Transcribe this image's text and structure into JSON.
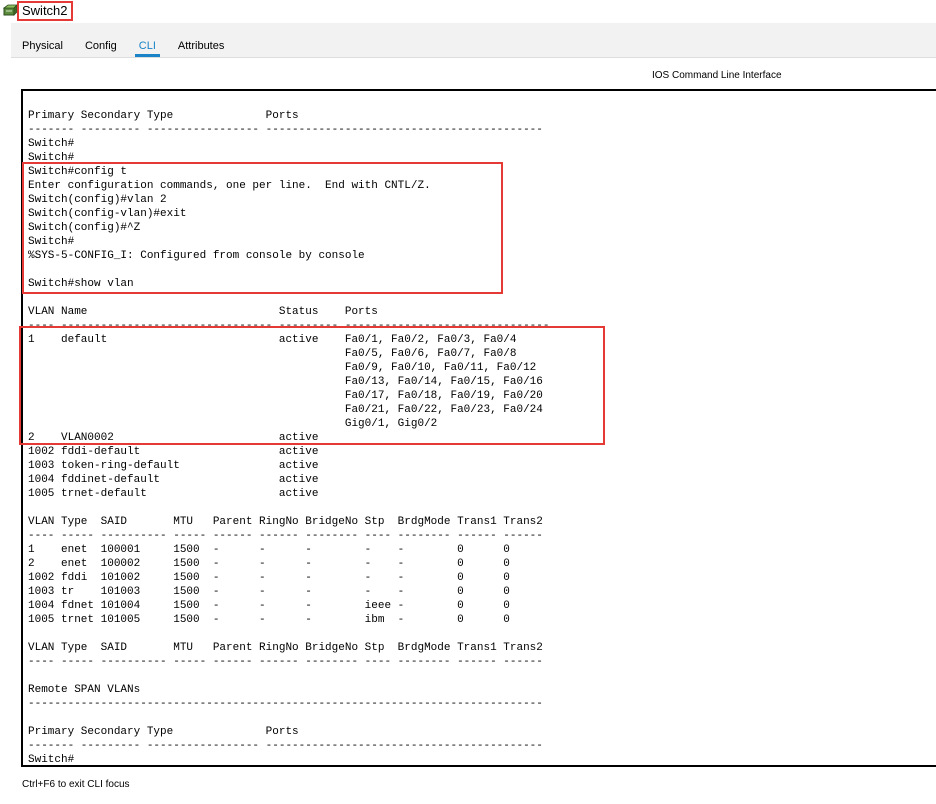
{
  "window": {
    "title": "Switch2"
  },
  "tabs": [
    {
      "label": "Physical"
    },
    {
      "label": "Config"
    },
    {
      "label": "CLI"
    },
    {
      "label": "Attributes"
    }
  ],
  "active_tab": "CLI",
  "panel": {
    "title": "IOS Command Line Interface"
  },
  "terminal": {
    "lines": [
      "Primary Secondary Type              Ports",
      "------- --------- ----------------- ------------------------------------------",
      "Switch#",
      "Switch#",
      "Switch#config t",
      "Enter configuration commands, one per line.  End with CNTL/Z.",
      "Switch(config)#vlan 2",
      "Switch(config-vlan)#exit",
      "Switch(config)#^Z",
      "Switch#",
      "%SYS-5-CONFIG_I: Configured from console by console",
      "",
      "Switch#show vlan",
      "",
      "VLAN Name                             Status    Ports",
      "---- -------------------------------- --------- -------------------------------",
      "1    default                          active    Fa0/1, Fa0/2, Fa0/3, Fa0/4",
      "                                                Fa0/5, Fa0/6, Fa0/7, Fa0/8",
      "                                                Fa0/9, Fa0/10, Fa0/11, Fa0/12",
      "                                                Fa0/13, Fa0/14, Fa0/15, Fa0/16",
      "                                                Fa0/17, Fa0/18, Fa0/19, Fa0/20",
      "                                                Fa0/21, Fa0/22, Fa0/23, Fa0/24",
      "                                                Gig0/1, Gig0/2",
      "2    VLAN0002                         active",
      "1002 fddi-default                     active",
      "1003 token-ring-default               active",
      "1004 fddinet-default                  active",
      "1005 trnet-default                    active",
      "",
      "VLAN Type  SAID       MTU   Parent RingNo BridgeNo Stp  BrdgMode Trans1 Trans2",
      "---- ----- ---------- ----- ------ ------ -------- ---- -------- ------ ------",
      "1    enet  100001     1500  -      -      -        -    -        0      0",
      "2    enet  100002     1500  -      -      -        -    -        0      0",
      "1002 fddi  101002     1500  -      -      -        -    -        0      0",
      "1003 tr    101003     1500  -      -      -        -    -        0      0",
      "1004 fdnet 101004     1500  -      -      -        ieee -        0      0",
      "1005 trnet 101005     1500  -      -      -        ibm  -        0      0",
      "",
      "VLAN Type  SAID       MTU   Parent RingNo BridgeNo Stp  BrdgMode Trans1 Trans2",
      "---- ----- ---------- ----- ------ ------ -------- ---- -------- ------ ------",
      "",
      "Remote SPAN VLANs",
      "------------------------------------------------------------------------------",
      "",
      "Primary Secondary Type              Ports",
      "------- --------- ----------------- ------------------------------------------",
      "Switch#"
    ]
  },
  "footer": {
    "hint": "Ctrl+F6 to exit CLI focus"
  },
  "colors": {
    "highlight": "#e53935",
    "active_tab": "#1a84c7"
  },
  "icons": {
    "app_icon": "switch-device-icon"
  }
}
